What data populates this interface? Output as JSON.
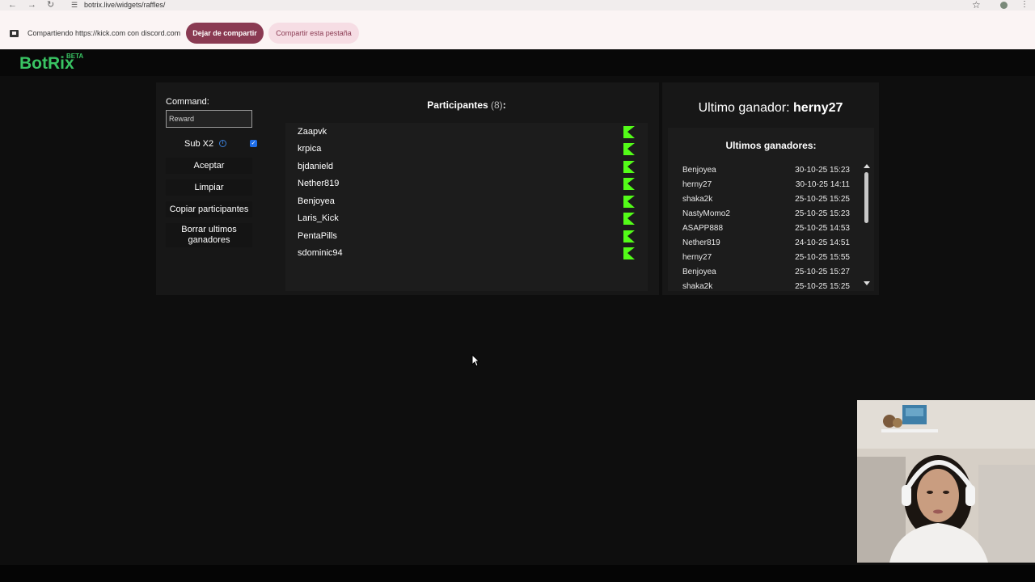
{
  "browser": {
    "url": "botrix.live/widgets/raffles/",
    "share_text": "Compartiendo https://kick.com con discord.com",
    "stop_sharing_label": "Dejar de compartir",
    "share_tab_label": "Compartir esta pestaña"
  },
  "header": {
    "logo": "BotRix",
    "beta": "BETA"
  },
  "controls": {
    "command_label": "Command:",
    "command_value": "Reward",
    "sub_label": "Sub X2",
    "sub_checked": true,
    "accept_label": "Aceptar",
    "clear_label": "Limpiar",
    "copy_label": "Copiar participantes",
    "delete_winners_label": "Borrar ultimos ganadores"
  },
  "participants": {
    "title": "Participantes",
    "count": "(8)",
    "suffix": ":",
    "items": [
      "Zaapvk",
      "krpica",
      "bjdanield",
      "Nether819",
      "Benjoyea",
      "Laris_Kick",
      "PentaPills",
      "sdominic94"
    ]
  },
  "winner": {
    "label": "Ultimo ganador:",
    "name": "herny27"
  },
  "recent_winners": {
    "title": "Ultimos ganadores:",
    "items": [
      {
        "name": "Benjoyea",
        "date": "30-10-25 15:23"
      },
      {
        "name": "herny27",
        "date": "30-10-25 14:11"
      },
      {
        "name": "shaka2k",
        "date": "25-10-25 15:25"
      },
      {
        "name": "NastyMomo2",
        "date": "25-10-25 15:23"
      },
      {
        "name": "ASAPP888",
        "date": "25-10-25 14:53"
      },
      {
        "name": "Nether819",
        "date": "24-10-25 14:51"
      },
      {
        "name": "herny27",
        "date": "25-10-25 15:55"
      },
      {
        "name": "Benjoyea",
        "date": "25-10-25 15:27"
      },
      {
        "name": "shaka2k",
        "date": "25-10-25 15:25"
      }
    ]
  },
  "colors": {
    "brand_green": "#39c463",
    "kick_green": "#53fc18",
    "stop_share_bg": "#8a3a52",
    "checkbox_blue": "#1f6ee8"
  }
}
